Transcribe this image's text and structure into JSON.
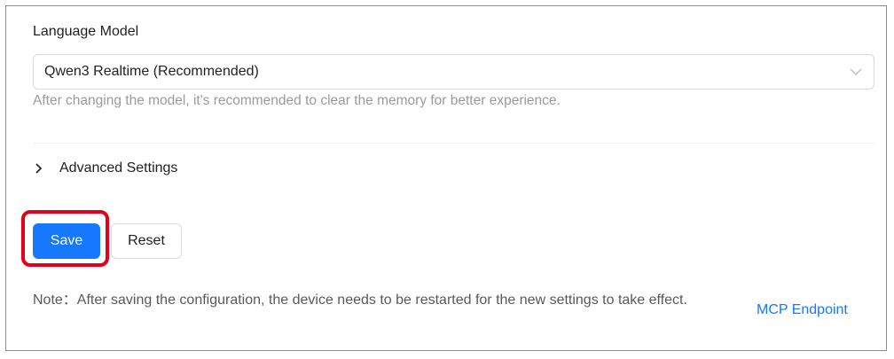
{
  "language_model": {
    "label": "Language Model",
    "selected_value": "Qwen3 Realtime (Recommended)",
    "hint": "After changing the model, it's recommended to clear the memory for better experience."
  },
  "advanced_settings": {
    "label": "Advanced Settings",
    "expanded": false
  },
  "actions": {
    "save_label": "Save",
    "reset_label": "Reset"
  },
  "footer": {
    "note": "Note：After saving the configuration, the device needs to be restarted for the new settings to take effect.",
    "link_label": "MCP Endpoint"
  },
  "colors": {
    "primary": "#1677ff",
    "highlight": "#e3001b",
    "border": "#d9d9d9",
    "hint_text": "#9a9a9a"
  }
}
